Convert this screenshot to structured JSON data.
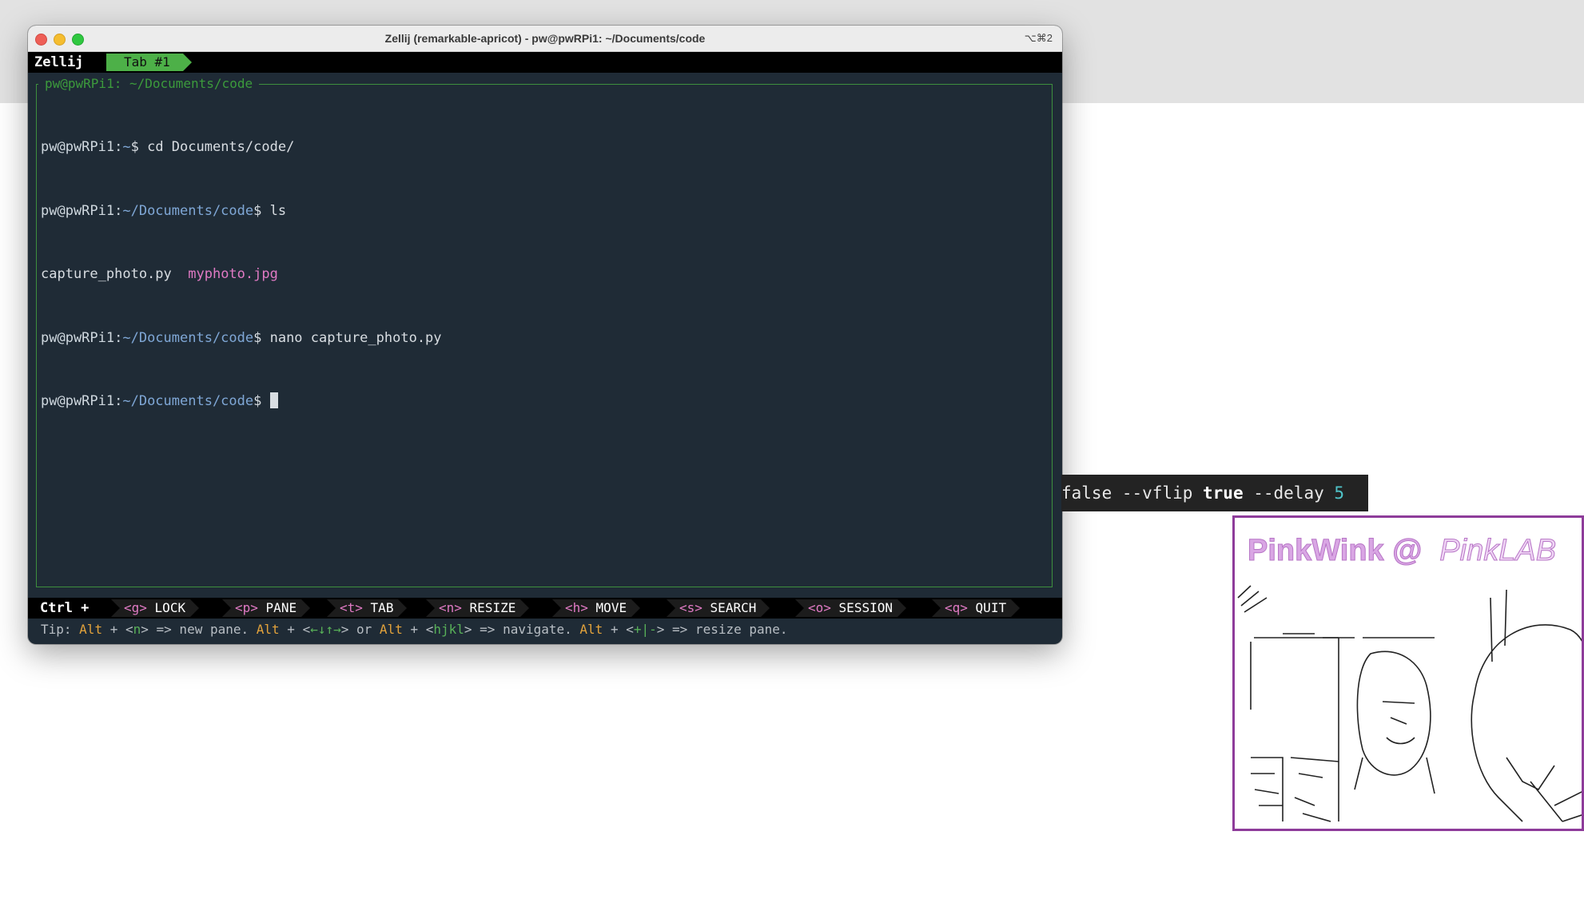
{
  "window": {
    "title": "Zellij (remarkable-apricot) - pw@pwRPi1: ~/Documents/code",
    "shortcut": "⌥⌘2"
  },
  "tabbar": {
    "app_label": "Zellij",
    "active_tab": "Tab #1"
  },
  "pane": {
    "title": "pw@pwRPi1: ~/Documents/code",
    "lines": [
      {
        "user": "pw@pwRPi1:",
        "path": "~",
        "cmd": "$ cd Documents/code/"
      },
      {
        "user": "pw@pwRPi1:",
        "path": "~/Documents/code",
        "cmd": "$ ls"
      },
      {
        "file1": "capture_photo.py",
        "file2": "myphoto.jpg"
      },
      {
        "user": "pw@pwRPi1:",
        "path": "~/Documents/code",
        "cmd": "$ nano capture_photo.py"
      },
      {
        "user": "pw@pwRPi1:",
        "path": "~/Documents/code",
        "cmd": "$ "
      }
    ]
  },
  "statusbar": {
    "modifier": "Ctrl +",
    "keys": [
      {
        "key": "<g>",
        "label": "LOCK"
      },
      {
        "key": "<p>",
        "label": "PANE"
      },
      {
        "key": "<t>",
        "label": "TAB"
      },
      {
        "key": "<n>",
        "label": "RESIZE"
      },
      {
        "key": "<h>",
        "label": "MOVE"
      },
      {
        "key": "<s>",
        "label": "SEARCH"
      },
      {
        "key": "<o>",
        "label": "SESSION"
      },
      {
        "key": "<q>",
        "label": "QUIT"
      }
    ],
    "tip": {
      "prefix": "Tip: ",
      "alt": "Alt",
      "plus": " + ",
      "n_open": "<",
      "n": "n",
      "n_close": "> => new pane. ",
      "arrows_open": "<",
      "arrows": "←↓↑→",
      "arrows_close": "> or ",
      "hjkl_open": "<",
      "hjkl": "hjkl",
      "hjkl_close": "> => navigate. ",
      "resize_open": "<",
      "resize": "+|-",
      "resize_close": "> => resize pane."
    }
  },
  "overlay": {
    "part1": "false --vflip ",
    "kw1": "true",
    "part2": " --delay ",
    "num": "5"
  },
  "camera": {
    "title": "PinkWink @",
    "subtitle": "PinkLAB"
  },
  "colors": {
    "terminal_bg": "#1f2b36",
    "tab_green": "#4db048",
    "prompt_path": "#7fa7d6",
    "key_pink": "#e07ac4",
    "tip_orange": "#e2a23b",
    "camera_border": "#8e3c9a"
  }
}
